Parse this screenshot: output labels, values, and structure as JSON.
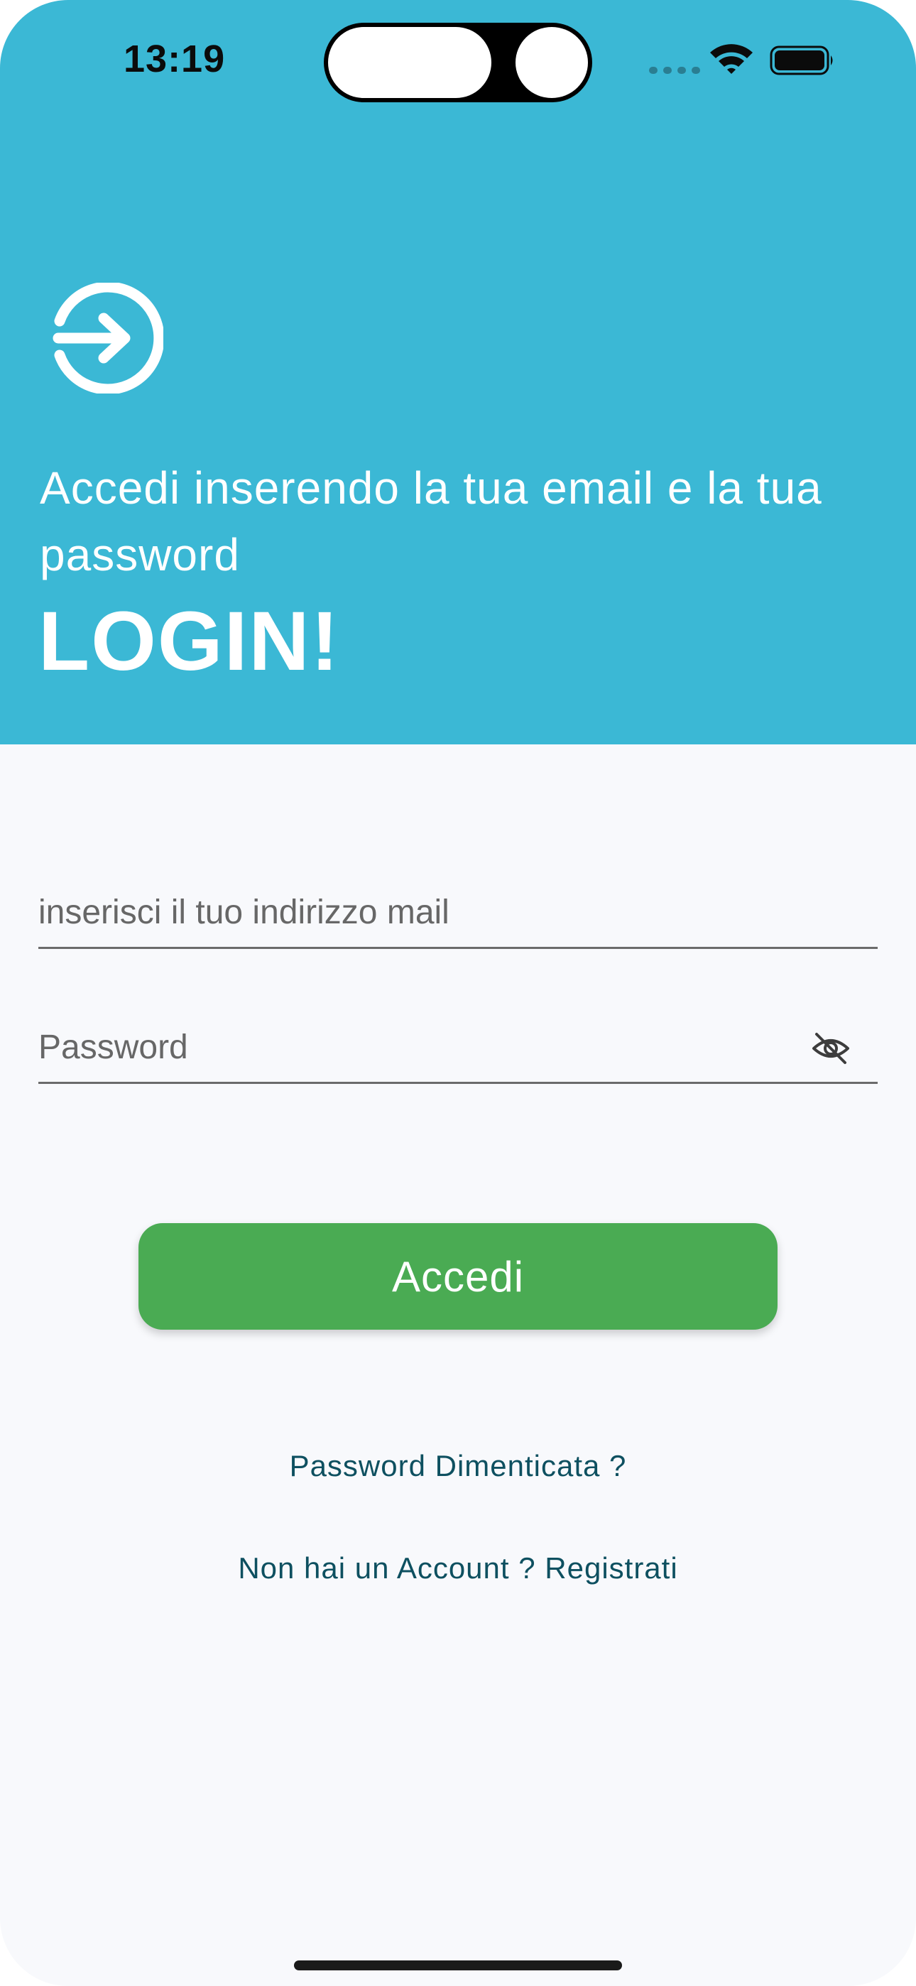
{
  "status_bar": {
    "time": "13:19"
  },
  "header": {
    "icon": "login-arrow-circle-icon",
    "subtitle": "Accedi inserendo la tua email e la tua password",
    "title": "LOGIN!",
    "background_color": "#3bb8d5"
  },
  "form": {
    "email_placeholder": "inserisci il tuo indirizzo mail",
    "email_value": "",
    "password_placeholder": "Password",
    "password_value": "",
    "password_toggle_icon": "eye-off-icon"
  },
  "actions": {
    "login_label": "Accedi",
    "login_color": "#4aab53",
    "forgot_password_label": "Password Dimenticata ?",
    "register_label": "Non hai un Account ? Registrati",
    "link_color": "#0e5060"
  }
}
